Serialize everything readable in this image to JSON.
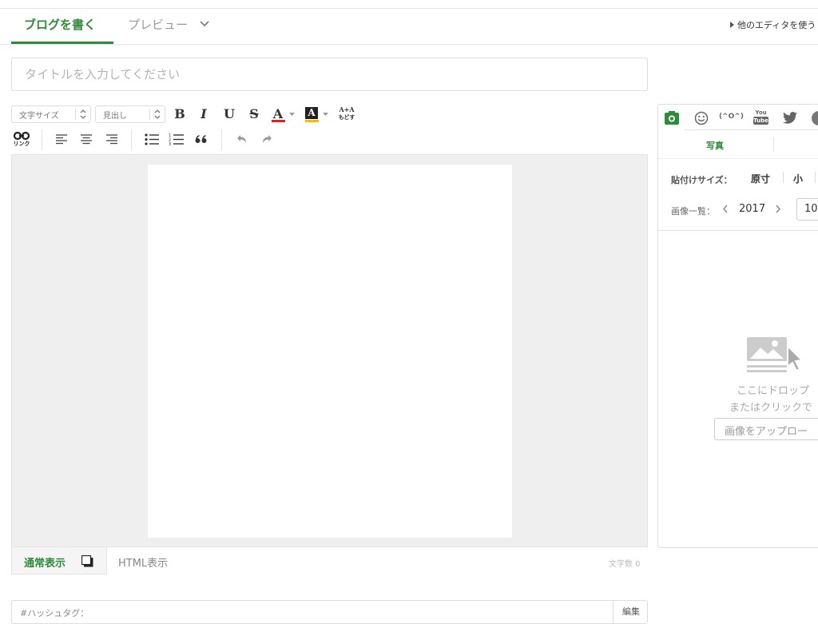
{
  "tabs": {
    "write": "ブログを書く",
    "preview": "プレビュー",
    "other_editor": "他のエディタを使う"
  },
  "title_field": {
    "placeholder": "タイトルを入力してください",
    "value": ""
  },
  "toolbar": {
    "font_size_select": "文字サイズ",
    "heading_select": "見出し",
    "bold": "B",
    "italic": "I",
    "underline": "U",
    "strike": "S",
    "text_color": "A",
    "bg_color": "A",
    "reset_top": "A+A",
    "reset_bottom": "もどす",
    "link_label": "リンク",
    "icons": [
      "link-icon",
      "align-left-icon",
      "align-center-icon",
      "align-right-icon",
      "bullet-list-icon",
      "numbered-list-icon",
      "quote-icon",
      "undo-icon",
      "redo-icon"
    ],
    "text_color_swatch": "#e02020",
    "bg_color_swatch": "#f0c000"
  },
  "editor_modes": {
    "normal": "通常表示",
    "html": "HTML表示",
    "char_count": "文字数 0"
  },
  "hashtag": {
    "label": "#ハッシュタグ：",
    "edit": "編集"
  },
  "side_panel": {
    "tabs": [
      "camera-icon",
      "emoji-icon",
      "kaomoji",
      "youtube-icon",
      "twitter-icon"
    ],
    "kaomoji_label": "(^O^)",
    "youtube_top": "You",
    "youtube_bottom": "Tube",
    "subtab_photo": "写真",
    "paste_size_label": "貼付けサイズ：",
    "size_original": "原寸",
    "size_small": "小",
    "image_list_label": "画像一覧：",
    "year": "2017",
    "month": "10",
    "drop_line1": "ここにドロップ",
    "drop_line2": "またはクリックで",
    "upload_button": "画像をアップロー"
  },
  "colors": {
    "accent": "#2e8b3a",
    "editor_bg": "#efefef"
  }
}
